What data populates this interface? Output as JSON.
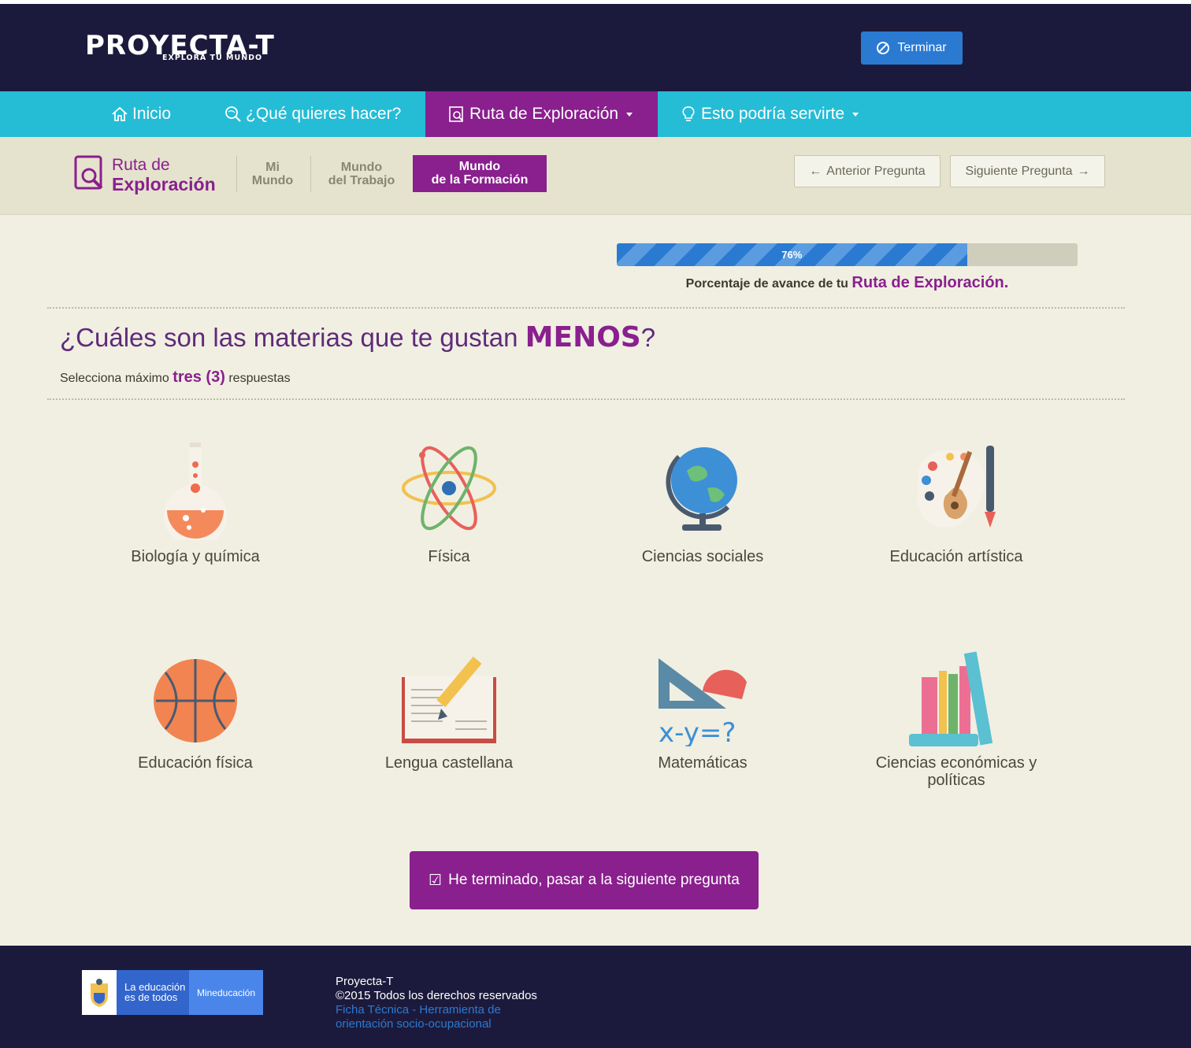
{
  "header": {
    "logo_main": "PROYECTA-T",
    "logo_sub": "EXPLORA TU MUNDO",
    "terminar_label": "Terminar"
  },
  "nav": {
    "items": [
      {
        "label": "Inicio",
        "icon": "home-icon"
      },
      {
        "label": "¿Qué quieres hacer?",
        "icon": "search-globe-icon"
      },
      {
        "label": "Ruta de Exploración",
        "icon": "document-search-icon",
        "active": true,
        "dropdown": true
      },
      {
        "label": "Esto podría servirte",
        "icon": "lightbulb-icon",
        "dropdown": true
      }
    ]
  },
  "subnav": {
    "title_line1": "Ruta de",
    "title_line2": "Exploración",
    "steps": [
      {
        "line1": "Mi",
        "line2": "Mundo"
      },
      {
        "line1": "Mundo",
        "line2": "del Trabajo"
      },
      {
        "line1": "Mundo",
        "line2": "de la Formación",
        "active": true
      }
    ],
    "prev_label": "Anterior Pregunta",
    "next_label": "Siguiente Pregunta"
  },
  "progress": {
    "value": 76,
    "text": "76%",
    "label_prefix": "Porcentaje de avance de tu",
    "label_emph": "Ruta de Exploración."
  },
  "question": {
    "text_prefix": "¿Cuáles son las materias que te gustan",
    "text_emph": "MENOS",
    "text_suffix": "?",
    "hint_prefix": "Selecciona máximo",
    "hint_emph": "tres (3)",
    "hint_suffix": "respuestas"
  },
  "options": [
    {
      "label": "Biología y química",
      "icon": "flask-icon"
    },
    {
      "label": "Física",
      "icon": "atom-icon"
    },
    {
      "label": "Ciencias sociales",
      "icon": "globe-icon"
    },
    {
      "label": "Educación artística",
      "icon": "palette-guitar-icon"
    },
    {
      "label": "Educación física",
      "icon": "basketball-icon"
    },
    {
      "label": "Lengua castellana",
      "icon": "book-pencil-icon"
    },
    {
      "label": "Matemáticas",
      "icon": "ruler-protractor-icon"
    },
    {
      "label": "Ciencias económicas y políticas",
      "icon": "books-icon"
    }
  ],
  "math_formula": "x-y=?",
  "submit_label": "He terminado, pasar a la siguiente pregunta",
  "footer": {
    "logo_text_line1": "La educación",
    "logo_text_line2": "es de todos",
    "logo_ministry": "Mineducación",
    "line1": "Proyecta-T",
    "line2": "©2015 Todos los derechos reservados",
    "link_line1": "Ficha Técnica - Herramienta de",
    "link_line2": "orientación socio-ocupacional"
  },
  "colors": {
    "navy": "#1c1a3c",
    "cyan": "#25bcd6",
    "purple": "#8a1f8e",
    "blue": "#2a7ad2",
    "beige": "#f0efe2"
  }
}
